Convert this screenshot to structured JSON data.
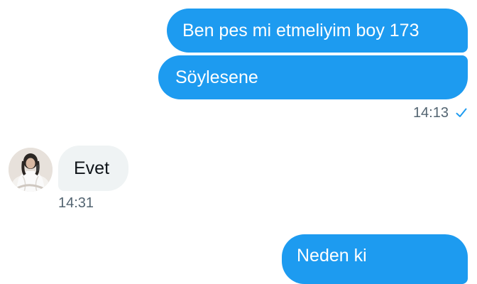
{
  "conversation": {
    "messages": [
      {
        "text": "Ben pes mi etmeliyim boy 173",
        "direction": "outgoing"
      },
      {
        "text": "Söylesene",
        "direction": "outgoing"
      },
      {
        "text": "Evet",
        "direction": "incoming"
      },
      {
        "text": "Neden ki",
        "direction": "outgoing"
      }
    ],
    "outgoing_time": "14:13",
    "incoming_time": "14:31",
    "read_status": "sent-check",
    "colors": {
      "outgoing_bubble": "#1d9bf0",
      "incoming_bubble": "#eff3f4",
      "timestamp": "#536471"
    }
  }
}
